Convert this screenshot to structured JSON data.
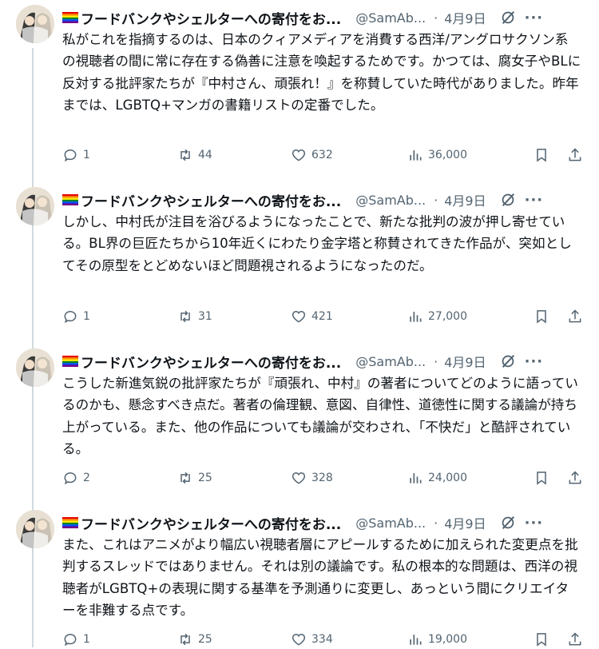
{
  "tweets": [
    {
      "author": "フードバンクやシェルターへの寄付をお...",
      "handle": "@SamAb...",
      "dot": "·",
      "date": "4月9日",
      "more": "···",
      "text": "私がこれを指摘するのは、日本のクィアメディアを消費する西洋/アングロサクソン系の視聴者の間に常に存在する偽善に注意を喚起するためです。かつては、腐女子やBLに反対する批評家たちが『中村さん、頑張れ！』を称賛していた時代がありました。昨年までは、LGBTQ+マンガの書籍リストの定番でした。",
      "replies": "1",
      "retweets": "44",
      "likes": "632",
      "views": "36,000"
    },
    {
      "author": "フードバンクやシェルターへの寄付をお...",
      "handle": "@SamAb...",
      "dot": "·",
      "date": "4月9日",
      "more": "···",
      "text": "しかし、中村氏が注目を浴びるようになったことで、新たな批判の波が押し寄せている。BL界の巨匠たちから10年近くにわたり金字塔と称賛されてきた作品が、突如としてその原型をとどめないほど問題視されるようになったのだ。",
      "replies": "1",
      "retweets": "31",
      "likes": "421",
      "views": "27,000"
    },
    {
      "author": "フードバンクやシェルターへの寄付をお...",
      "handle": "@SamAb...",
      "dot": "·",
      "date": "4月9日",
      "more": "···",
      "text": "こうした新進気鋭の批評家たちが『頑張れ、中村』の著者についてどのように語っているのかも、懸念すべき点だ。著者の倫理観、意図、自律性、道徳性に関する議論が持ち上がっている。また、他の作品についても議論が交わされ、「不快だ」と酷評されている。",
      "replies": "2",
      "retweets": "25",
      "likes": "328",
      "views": "24,000"
    },
    {
      "author": "フードバンクやシェルターへの寄付をお...",
      "handle": "@SamAb...",
      "dot": "·",
      "date": "4月9日",
      "more": "···",
      "text": "また、これはアニメがより幅広い視聴者層にアピールするために加えられた変更点を批判するスレッドではありません。それは別の議論です。私の根本的な問題は、西洋の視聴者がLGBTQ+の表現に関する基準を予測通りに変更し、あっという間にクリエイターを非難する点です。",
      "replies": "1",
      "retweets": "25",
      "likes": "334",
      "views": "19,000"
    }
  ],
  "colors": {
    "text": "#0f1419",
    "secondary": "#536471",
    "thread_line": "#cfd9de"
  }
}
